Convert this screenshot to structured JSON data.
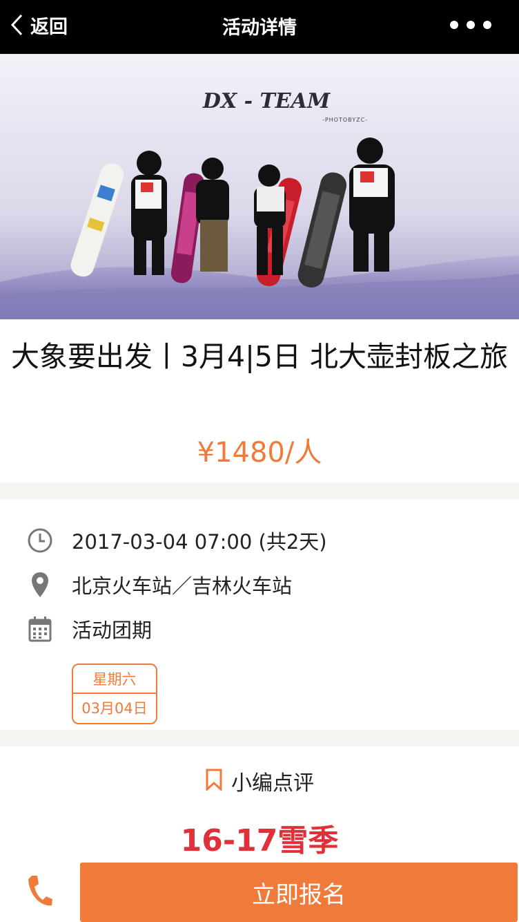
{
  "navbar": {
    "back_label": "返回",
    "title": "活动详情"
  },
  "hero": {
    "watermark_title": "DX - TEAM",
    "watermark_sub": "-PHOTOBYZC-"
  },
  "event": {
    "title": "大象要出发丨3月4|5日 北大壶封板之旅",
    "price": "¥1480/人"
  },
  "details": {
    "datetime": "2017-03-04 07:00 (共2天)",
    "location": "北京火车站／吉林火车站",
    "schedule_label": "活动团期",
    "date_chip": {
      "weekday": "星期六",
      "date": "03月04日"
    }
  },
  "review": {
    "label": "小编点评",
    "season": "16-17雪季"
  },
  "actions": {
    "signup_label": "立即报名"
  },
  "colors": {
    "accent": "#f07a3a",
    "season_red": "#e0313a"
  }
}
